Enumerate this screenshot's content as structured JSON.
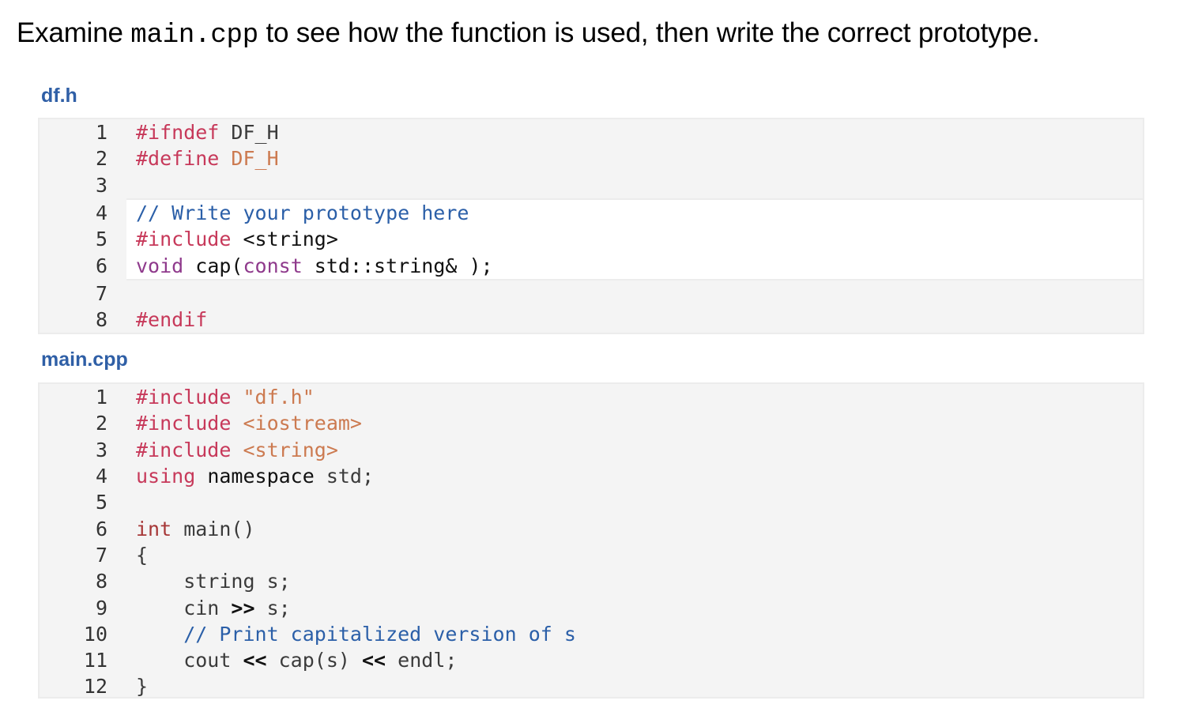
{
  "instructions": {
    "before": "Examine ",
    "code_ref": "main.cpp",
    "after": " to see how the function is used, then write the correct prototype."
  },
  "files": [
    {
      "name": "df.h",
      "lines": [
        {
          "num": "1",
          "tokens": [
            {
              "t": "#ifndef ",
              "c": "pp"
            },
            {
              "t": "DF_H",
              "c": "plain"
            }
          ]
        },
        {
          "num": "2",
          "tokens": [
            {
              "t": "#define ",
              "c": "pp"
            },
            {
              "t": "DF_H",
              "c": "str"
            }
          ]
        },
        {
          "num": "3",
          "tokens": []
        },
        {
          "num": "4",
          "editable": true,
          "tokens": [
            {
              "t": "// Write your prototype here",
              "c": "cmt"
            }
          ]
        },
        {
          "num": "5",
          "editable": true,
          "tokens": [
            {
              "t": "#include",
              "c": "pp"
            },
            {
              "t": " <string>",
              "c": "plain"
            }
          ]
        },
        {
          "num": "6",
          "editable": true,
          "tokens": [
            {
              "t": "void",
              "c": "ukw"
            },
            {
              "t": " cap(",
              "c": "plain"
            },
            {
              "t": "const",
              "c": "ukw"
            },
            {
              "t": " std::string& );",
              "c": "plain"
            }
          ]
        },
        {
          "num": "7",
          "tokens": []
        },
        {
          "num": "8",
          "tokens": [
            {
              "t": "#endif",
              "c": "pp"
            }
          ]
        }
      ]
    },
    {
      "name": "main.cpp",
      "lines": [
        {
          "num": "1",
          "tokens": [
            {
              "t": "#include ",
              "c": "pp"
            },
            {
              "t": "\"df.h\"",
              "c": "str"
            }
          ]
        },
        {
          "num": "2",
          "tokens": [
            {
              "t": "#include ",
              "c": "pp"
            },
            {
              "t": "<iostream>",
              "c": "str"
            }
          ]
        },
        {
          "num": "3",
          "tokens": [
            {
              "t": "#include ",
              "c": "pp"
            },
            {
              "t": "<string>",
              "c": "str"
            }
          ]
        },
        {
          "num": "4",
          "tokens": [
            {
              "t": "using",
              "c": "kw"
            },
            {
              "t": " namespace",
              "c": "dark"
            },
            {
              "t": " std;",
              "c": "plain"
            }
          ]
        },
        {
          "num": "5",
          "tokens": []
        },
        {
          "num": "6",
          "tokens": [
            {
              "t": "int",
              "c": "type"
            },
            {
              "t": " main()",
              "c": "plain"
            }
          ]
        },
        {
          "num": "7",
          "tokens": [
            {
              "t": "{",
              "c": "plain"
            }
          ]
        },
        {
          "num": "8",
          "tokens": [
            {
              "t": "    string s;",
              "c": "plain"
            }
          ]
        },
        {
          "num": "9",
          "tokens": [
            {
              "t": "    cin ",
              "c": "plain"
            },
            {
              "t": ">>",
              "c": "op"
            },
            {
              "t": " s;",
              "c": "plain"
            }
          ]
        },
        {
          "num": "10",
          "tokens": [
            {
              "t": "    // Print capitalized version of s",
              "c": "cmt"
            }
          ]
        },
        {
          "num": "11",
          "tokens": [
            {
              "t": "    cout ",
              "c": "plain"
            },
            {
              "t": "<<",
              "c": "op"
            },
            {
              "t": " cap(s) ",
              "c": "plain"
            },
            {
              "t": "<<",
              "c": "op"
            },
            {
              "t": " endl;",
              "c": "plain"
            }
          ]
        },
        {
          "num": "12",
          "tokens": [
            {
              "t": "}",
              "c": "plain"
            }
          ]
        }
      ]
    }
  ],
  "colors": {
    "file_label": "#2f5fa6",
    "preprocessor": "#c7395a",
    "string_literal": "#cc7a50",
    "comment": "#2b5fa8",
    "user_keyword": "#8f3a8c",
    "type_keyword": "#a63737",
    "code_background": "#f4f4f4",
    "editable_background": "#ffffff"
  }
}
